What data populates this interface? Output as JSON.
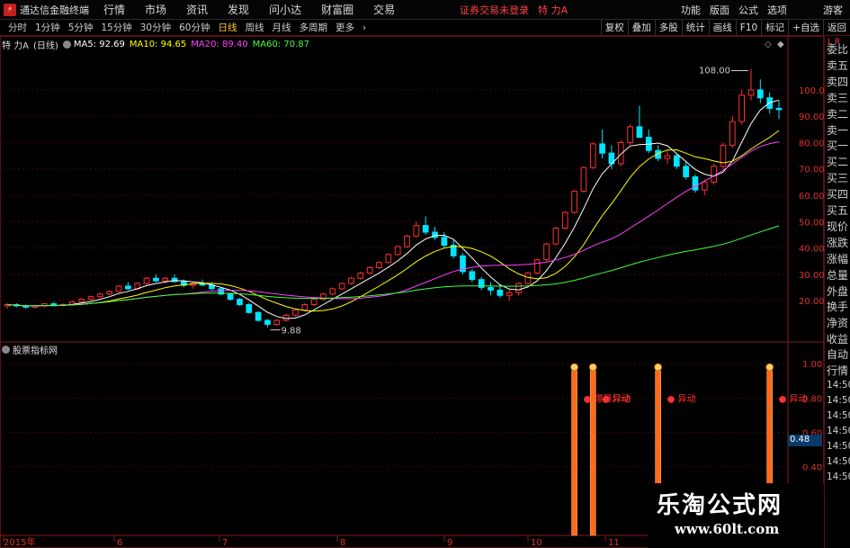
{
  "menubar": {
    "app_title": "通达信金融终端",
    "items": [
      "行情",
      "市场",
      "资讯",
      "发现",
      "问小达",
      "财富圈",
      "交易"
    ],
    "login_status": "证券交易未登录",
    "stock_name": "特 力A",
    "right_items": [
      "功能",
      "版面",
      "公式",
      "选项"
    ],
    "guest": "游客"
  },
  "tabs": {
    "periods": [
      "分时",
      "1分钟",
      "5分钟",
      "15分钟",
      "30分钟",
      "60分钟",
      "日线",
      "周线",
      "月线",
      "多周期",
      "更多"
    ],
    "active": "日线",
    "tools": [
      "复权",
      "叠加",
      "多股",
      "统计",
      "画线",
      "F10",
      "标记",
      "+自选",
      "返回"
    ]
  },
  "chart_info": {
    "stock": "特 力A",
    "period": "(日线)",
    "ma5": "MA5: 92.69",
    "ma10": "MA10: 94.65",
    "ma20": "MA20: 89.40",
    "ma60": "MA60: 70.87",
    "colors": {
      "ma5": "#ffffff",
      "ma10": "#ffff00",
      "ma20": "#ff40ff",
      "ma60": "#40ff40"
    }
  },
  "sidebar": {
    "top": "L R",
    "labels": [
      "委比",
      "卖五",
      "卖四",
      "卖三",
      "卖二",
      "卖一",
      "买一",
      "买二",
      "买三",
      "买四",
      "买五",
      "现价",
      "涨跌",
      "涨幅",
      "总量",
      "外盘",
      "换手",
      "净资",
      "收益",
      "自动",
      "行情",
      "14:50",
      "14:50",
      "14:50",
      "14:50",
      "14:50",
      "14:50",
      "14:50"
    ]
  },
  "sub_chart": {
    "title": "股票指标网",
    "current_value": "0.48",
    "signal_text": "异动",
    "signal_text_1": "爆量异动"
  },
  "watermark": {
    "cn": "乐淘公式网",
    "url": "www.60lt.com"
  },
  "chart_data": {
    "type": "candlestick",
    "price_axis": [
      "100.00",
      "90.00",
      "80.00",
      "70.00",
      "60.00",
      "50.00",
      "40.00",
      "30.00",
      "20.00"
    ],
    "sub_axis": [
      "1.00",
      "0.80",
      "0.60",
      "0.40"
    ],
    "time_axis": [
      "2015年",
      "6",
      "7",
      "8",
      "9",
      "10",
      "11"
    ],
    "annotation_high": "108.00",
    "annotation_low": "9.88",
    "ylim": [
      5,
      115
    ],
    "sub_ylim": [
      0,
      1.1
    ],
    "candles": [
      [
        18,
        19,
        17,
        18.5
      ],
      [
        18.5,
        19,
        17.5,
        18
      ],
      [
        18,
        18.5,
        17,
        17.5
      ],
      [
        17.5,
        18.5,
        17,
        18
      ],
      [
        18,
        19,
        17.5,
        18.8
      ],
      [
        18.8,
        19.5,
        18,
        18.2
      ],
      [
        18.2,
        19,
        17.8,
        18.5
      ],
      [
        18.5,
        20,
        18,
        19.5
      ],
      [
        19.5,
        21,
        19,
        20.5
      ],
      [
        20.5,
        22,
        20,
        21.5
      ],
      [
        21.5,
        23,
        21,
        22.5
      ],
      [
        22.5,
        24,
        22,
        23.5
      ],
      [
        23.5,
        26,
        23,
        25.5
      ],
      [
        25.5,
        27,
        24,
        24.5
      ],
      [
        24.5,
        27,
        24,
        26.5
      ],
      [
        26.5,
        29,
        26,
        28.5
      ],
      [
        28.5,
        30,
        27,
        27.5
      ],
      [
        27.5,
        29,
        26.5,
        28.5
      ],
      [
        28.5,
        30,
        27,
        27.2
      ],
      [
        27.2,
        28,
        25,
        25.8
      ],
      [
        25.8,
        27,
        24.5,
        26.5
      ],
      [
        26.5,
        28,
        25.5,
        25.9
      ],
      [
        25.9,
        27,
        24,
        24.5
      ],
      [
        24.5,
        25,
        22,
        22.5
      ],
      [
        22.5,
        23,
        20,
        20.5
      ],
      [
        20.5,
        21,
        18,
        18.5
      ],
      [
        18.5,
        19,
        15,
        15.5
      ],
      [
        15.5,
        16,
        12,
        12.5
      ],
      [
        12.5,
        13,
        9.9,
        11
      ],
      [
        11,
        13,
        10.5,
        12.5
      ],
      [
        12.5,
        15,
        12,
        14.5
      ],
      [
        14.5,
        17,
        14,
        16.5
      ],
      [
        16.5,
        19,
        16,
        18.5
      ],
      [
        18.5,
        21,
        18,
        20.5
      ],
      [
        20.5,
        23,
        20,
        22.5
      ],
      [
        22.5,
        25,
        22,
        24.5
      ],
      [
        24.5,
        27,
        24,
        26.5
      ],
      [
        26.5,
        29,
        26,
        28.5
      ],
      [
        28.5,
        31,
        28,
        30.5
      ],
      [
        30.5,
        33,
        30,
        32.5
      ],
      [
        32.5,
        35,
        32,
        34.5
      ],
      [
        34.5,
        38,
        34,
        37.5
      ],
      [
        37.5,
        41,
        37,
        40.5
      ],
      [
        40.5,
        45,
        40,
        44.5
      ],
      [
        44.5,
        50,
        44,
        48.5
      ],
      [
        48.5,
        52,
        45,
        46
      ],
      [
        46,
        48,
        43,
        44
      ],
      [
        44,
        46,
        40,
        41
      ],
      [
        41,
        43,
        36,
        37
      ],
      [
        37,
        38,
        30,
        31
      ],
      [
        31,
        32,
        27,
        28
      ],
      [
        28,
        29,
        24,
        25
      ],
      [
        25,
        27,
        22,
        24
      ],
      [
        24,
        26,
        21,
        22
      ],
      [
        22,
        24,
        20,
        23
      ],
      [
        23,
        27,
        22,
        26.5
      ],
      [
        26.5,
        31,
        26,
        30.5
      ],
      [
        30.5,
        36,
        30,
        35.5
      ],
      [
        35.5,
        42,
        35,
        41.5
      ],
      [
        41.5,
        48,
        41,
        47.5
      ],
      [
        47.5,
        54,
        47,
        53.5
      ],
      [
        53.5,
        62,
        53,
        61.5
      ],
      [
        61.5,
        71,
        61,
        70.5
      ],
      [
        70.5,
        80,
        70,
        79.5
      ],
      [
        79.5,
        85,
        74,
        76
      ],
      [
        76,
        79,
        70,
        72
      ],
      [
        72,
        81,
        71,
        80
      ],
      [
        80,
        87,
        79,
        86
      ],
      [
        86,
        94,
        85,
        82
      ],
      [
        82,
        85,
        76,
        77
      ],
      [
        77,
        79,
        73,
        74
      ],
      [
        74,
        77,
        72,
        75
      ],
      [
        75,
        76,
        70,
        71
      ],
      [
        71,
        73,
        66,
        67
      ],
      [
        67,
        68,
        61,
        62
      ],
      [
        62,
        66,
        60,
        65
      ],
      [
        65,
        72,
        64,
        71
      ],
      [
        71,
        80,
        70,
        79
      ],
      [
        79,
        90,
        78,
        88
      ],
      [
        88,
        100,
        87,
        98
      ],
      [
        98,
        108,
        96,
        100
      ],
      [
        100,
        104,
        95,
        97
      ],
      [
        97,
        99,
        91,
        93
      ],
      [
        93,
        96,
        89,
        92.5
      ]
    ],
    "signals": [
      {
        "index": 61,
        "value": 1.0
      },
      {
        "index": 63,
        "value": 1.0
      },
      {
        "index": 70,
        "value": 1.0
      },
      {
        "index": 82,
        "value": 1.0
      }
    ]
  }
}
